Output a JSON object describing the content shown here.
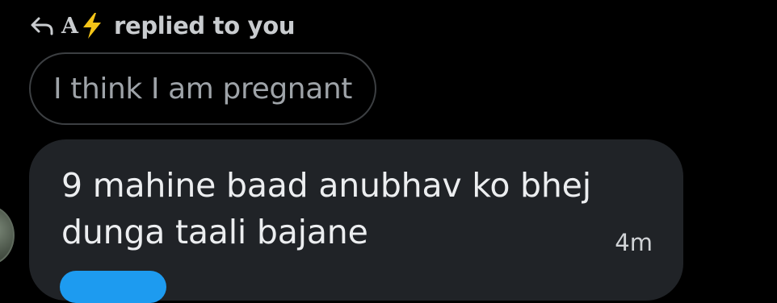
{
  "reply_header": {
    "arrow_icon": "reply-arrow-icon",
    "sender_name": "A",
    "sender_emoji_icon": "lightning-bolt-icon",
    "action_text": "replied to you"
  },
  "quoted_message": {
    "text": "I think I am pregnant"
  },
  "message": {
    "line1": "9 mahine baad anubhav ko bhej",
    "line2": "dunga taali bajane",
    "timestamp": "4m"
  },
  "colors": {
    "background": "#000000",
    "bubble": "#202327",
    "accent": "#1d9bf0",
    "bolt": "#f5c518"
  }
}
